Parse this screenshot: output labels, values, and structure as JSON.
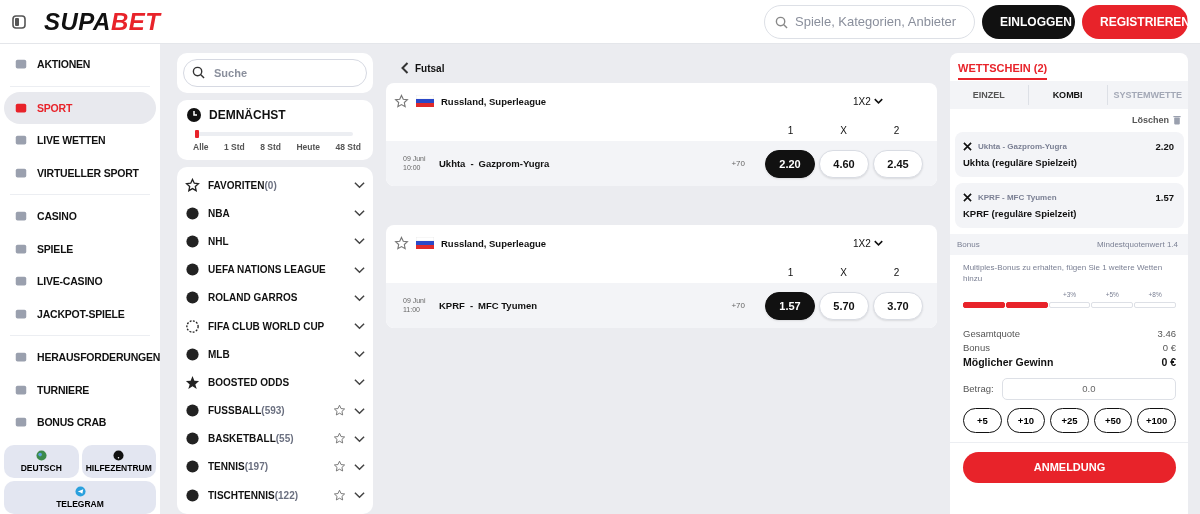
{
  "header": {
    "logo": [
      "SUPA",
      "BET"
    ],
    "search": {
      "placeholder": "Spiele, Kategorien, Anbieter"
    },
    "login": "EINLOGGEN",
    "register": "REGISTRIEREN"
  },
  "sidebar": {
    "groups": [
      [
        {
          "label": "AKTIONEN",
          "selected": false
        }
      ],
      [
        {
          "label": "SPORT",
          "selected": true
        },
        {
          "label": "LIVE WETTEN",
          "selected": false
        },
        {
          "label": "VIRTUELLER SPORT",
          "selected": false
        }
      ],
      [
        {
          "label": "CASINO",
          "selected": false
        },
        {
          "label": "SPIELE",
          "selected": false
        },
        {
          "label": "LIVE-CASINO",
          "selected": false
        },
        {
          "label": "JACKPOT-SPIELE",
          "selected": false
        }
      ],
      [
        {
          "label": "HERAUSFORDERUNGEN",
          "selected": false
        },
        {
          "label": "TURNIERE",
          "selected": false
        },
        {
          "label": "BONUS CRAB",
          "selected": false
        }
      ]
    ],
    "buttons": [
      {
        "label": "DEUTSCH",
        "kind": "globe"
      },
      {
        "label": "HILFEZENTRUM",
        "kind": "help"
      },
      {
        "label": "TELEGRAM",
        "kind": "telegram"
      }
    ]
  },
  "filters": {
    "search": {
      "placeholder": "Suche"
    },
    "upcoming": {
      "title": "DEMNÄCHST",
      "level": 0,
      "stops": [
        "Alle",
        "1 Std",
        "8 Std",
        "Heute",
        "48 Std"
      ]
    },
    "sports": [
      {
        "name": "FAVORITEN",
        "count": "(0)",
        "favoritable": false
      },
      {
        "name": "NBA",
        "favoritable": false
      },
      {
        "name": "NHL",
        "favoritable": false
      },
      {
        "name": "UEFA NATIONS LEAGUE",
        "favoritable": false
      },
      {
        "name": "ROLAND GARROS",
        "favoritable": false
      },
      {
        "name": "FIFA CLUB WORLD CUP",
        "favoritable": false
      },
      {
        "name": "MLB",
        "favoritable": false
      },
      {
        "name": "BOOSTED ODDS",
        "favoritable": false
      },
      {
        "name": "FUSSBALL",
        "count": "(593)",
        "favoritable": true
      },
      {
        "name": "BASKETBALL",
        "count": "(55)",
        "favoritable": true
      },
      {
        "name": "TENNIS",
        "count": "(197)",
        "favoritable": true
      },
      {
        "name": "TISCHTENNIS",
        "count": "(122)",
        "favoritable": true
      }
    ]
  },
  "content": {
    "back": "Futsal",
    "events": [
      {
        "league": "Russland, Superleague",
        "market": "1X2",
        "labels": [
          "1",
          "X",
          "2"
        ],
        "date": "09 Juni",
        "time": "10:00",
        "home": "Ukhta",
        "sep": "-",
        "away": "Gazprom-Yugra",
        "more": "+70",
        "odds": [
          {
            "value": "2.20",
            "selected": true
          },
          {
            "value": "4.60",
            "selected": false
          },
          {
            "value": "2.45",
            "selected": false
          }
        ]
      },
      {
        "league": "Russland, Superleague",
        "market": "1X2",
        "labels": [
          "1",
          "X",
          "2"
        ],
        "date": "09 Juni",
        "time": "11:00",
        "home": "KPRF",
        "sep": "-",
        "away": "MFC Tyumen",
        "more": "+70",
        "odds": [
          {
            "value": "1.57",
            "selected": true
          },
          {
            "value": "5.70",
            "selected": false
          },
          {
            "value": "3.70",
            "selected": false
          }
        ]
      }
    ]
  },
  "betslip": {
    "title": "WETTSCHEIN (2)",
    "tabs": [
      {
        "label": "EINZEL",
        "selected": false,
        "disabled": false
      },
      {
        "label": "KOMBI",
        "selected": true,
        "disabled": false
      },
      {
        "label": "SYSTEMWETTE",
        "selected": false,
        "disabled": true
      }
    ],
    "clear": "Löschen",
    "selections": [
      {
        "match": "Ukhta - Gazprom-Yugra",
        "odds": "2.20",
        "pick": "Ukhta (reguläre Spielzeit)"
      },
      {
        "match": "KPRF - MFC Tyumen",
        "odds": "1.57",
        "pick": "KPRF (reguläre Spielzeit)"
      }
    ],
    "bonus": {
      "label": "Bonus",
      "min": "Mindestquotenwert 1.4",
      "text": "Multiples-Bonus zu erhalten, fügen Sie 1 weitere Wetten hinzu",
      "segments": [
        {
          "filled": true
        },
        {
          "filled": true
        },
        {
          "filled": false,
          "label": "+3%"
        },
        {
          "filled": false,
          "label": "+5%"
        },
        {
          "filled": false,
          "label": "+8%"
        }
      ]
    },
    "totals": [
      {
        "label": "Gesamtquote",
        "value": "3.46",
        "strong": false
      },
      {
        "label": "Bonus",
        "value": "0 €",
        "strong": false
      },
      {
        "label": "Möglicher Gewinn",
        "value": "0 €",
        "strong": true
      }
    ],
    "stake": {
      "label": "Betrag:",
      "value": "0.0"
    },
    "quick": [
      "+5",
      "+10",
      "+25",
      "+50",
      "+100"
    ],
    "submit": "ANMELDUNG"
  }
}
